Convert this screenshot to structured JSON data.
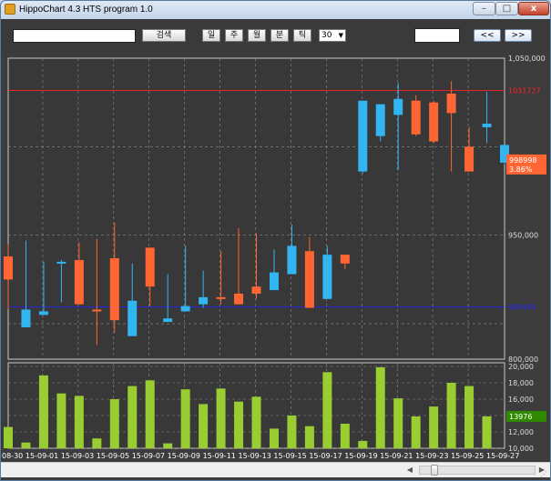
{
  "window": {
    "title": "HippoChart 4.3 HTS program 1.0",
    "controls": {
      "minimize": "–",
      "maximize": "□",
      "close": "x"
    }
  },
  "toolbar": {
    "search_value": "",
    "search_button": "검색",
    "period_buttons": [
      "일",
      "주",
      "월",
      "분",
      "틱"
    ],
    "period_count": "30",
    "date_field": "",
    "prev_button": "<<",
    "next_button": ">>"
  },
  "colors": {
    "background": "#383838",
    "up": "#ff6633",
    "down": "#33b5f2",
    "volume": "#9acd32",
    "max_line": "#ff2222",
    "min_line": "#2222ff",
    "grid": "#8c8c8c",
    "current_label_bg": "#ff6633",
    "volume_label_bg": "#2e8b00"
  },
  "chart_data": {
    "type": "candlestick",
    "price_axis": {
      "ticks": [
        800000,
        950000,
        1050000
      ],
      "tick_labels": [
        "800,000",
        "950,000",
        "1,050,000"
      ],
      "range": [
        880000,
        1050000
      ]
    },
    "volume_axis": {
      "ticks": [
        10000,
        12000,
        14000,
        16000,
        18000,
        20000
      ],
      "tick_labels": [
        "10,000",
        "12,000",
        "14,000",
        "16,000",
        "18,000",
        "20,000"
      ],
      "range": [
        10000,
        20000
      ]
    },
    "x_tick_labels": [
      "08-30",
      "15-09-01",
      "15-09-03",
      "15-09-05",
      "15-09-07",
      "15-09-09",
      "15-09-11",
      "15-09-13",
      "15-09-15",
      "15-09-17",
      "15-09-19",
      "15-09-21",
      "15-09-23",
      "15-09-25",
      "15-09-27"
    ],
    "max_line": {
      "value": 1031727,
      "label": "1031727"
    },
    "min_line": {
      "value": 909440,
      "label": "909440"
    },
    "current": {
      "price_label": "998998",
      "change_label": "3.86%",
      "volume_label": "13976"
    },
    "candles": [
      {
        "o": 925000,
        "h": 945000,
        "l": 908000,
        "c": 938000
      },
      {
        "o": 908000,
        "h": 947000,
        "l": 905000,
        "c": 898000
      },
      {
        "o": 907000,
        "h": 935000,
        "l": 906000,
        "c": 905000
      },
      {
        "o": 935000,
        "h": 936000,
        "l": 912000,
        "c": 934000
      },
      {
        "o": 911000,
        "h": 946000,
        "l": 911000,
        "c": 936000
      },
      {
        "o": 908000,
        "h": 948000,
        "l": 888000,
        "c": 908000
      },
      {
        "o": 902000,
        "h": 957000,
        "l": 895000,
        "c": 937000
      },
      {
        "o": 913000,
        "h": 934000,
        "l": 903000,
        "c": 893000
      },
      {
        "o": 921000,
        "h": 934000,
        "l": 910000,
        "c": 943000
      },
      {
        "o": 903000,
        "h": 928000,
        "l": 902000,
        "c": 901000
      },
      {
        "o": 910000,
        "h": 944000,
        "l": 907000,
        "c": 907000
      },
      {
        "o": 915000,
        "h": 930000,
        "l": 909000,
        "c": 911000
      },
      {
        "o": 915000,
        "h": 941000,
        "l": 911000,
        "c": 915000
      },
      {
        "o": 911000,
        "h": 954000,
        "l": 911000,
        "c": 917000
      },
      {
        "o": 917000,
        "h": 951000,
        "l": 914000,
        "c": 921000
      },
      {
        "o": 929000,
        "h": 942000,
        "l": 924000,
        "c": 919000
      },
      {
        "o": 944000,
        "h": 956000,
        "l": 929000,
        "c": 928000
      },
      {
        "o": 909000,
        "h": 949000,
        "l": 909000,
        "c": 941000
      },
      {
        "o": 939000,
        "h": 944000,
        "l": 914000,
        "c": 914000
      },
      {
        "o": 934000,
        "h": 934000,
        "l": 931000,
        "c": 939000
      },
      {
        "o": 1026000,
        "h": 1026000,
        "l": 985000,
        "c": 986000
      },
      {
        "o": 1024000,
        "h": 1024000,
        "l": 1003000,
        "c": 1006000
      },
      {
        "o": 1027000,
        "h": 1036000,
        "l": 987000,
        "c": 1018000
      },
      {
        "o": 1007000,
        "h": 1029000,
        "l": 1006000,
        "c": 1026000
      },
      {
        "o": 1003000,
        "h": 1026000,
        "l": 1002000,
        "c": 1025000
      },
      {
        "o": 1019000,
        "h": 1037000,
        "l": 986000,
        "c": 1030000
      },
      {
        "o": 986000,
        "h": 1011000,
        "l": 986000,
        "c": 1000000
      },
      {
        "o": 1013000,
        "h": 1031000,
        "l": 1002000,
        "c": 1011000
      },
      {
        "o": 1001000,
        "h": 1001000,
        "l": 990000,
        "c": 991000
      }
    ],
    "volumes": [
      12600,
      10700,
      18900,
      16700,
      16400,
      11200,
      16000,
      17600,
      18300,
      10600,
      17200,
      15400,
      17300,
      15700,
      16300,
      12400,
      14000,
      12700,
      19300,
      13000,
      10900,
      19900,
      16100,
      13900,
      15100,
      18000,
      17600,
      13900
    ]
  }
}
